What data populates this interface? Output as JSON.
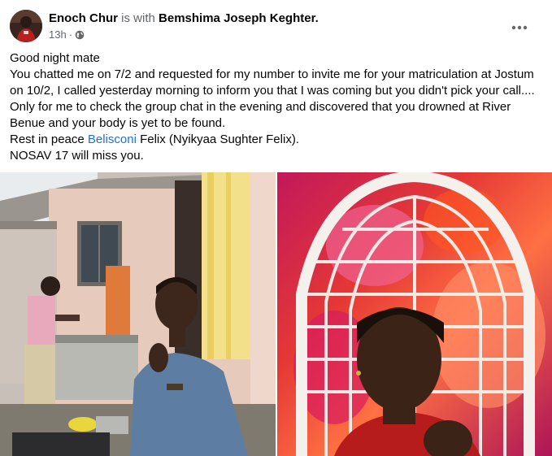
{
  "post": {
    "author": "Enoch Chur",
    "with_text": "is with",
    "tagged": "Bemshima Joseph Keghter.",
    "time": "13h",
    "separator": "·",
    "privacy_icon": "globe-icon",
    "more_icon": "more-options-icon",
    "lines": [
      "Good night mate",
      "You chatted me on 7/2 and requested for my number to invite me for your matriculation at Jostum on 10/2, I called yesterday morning to inform you that I was coming but you didn't pick your call.... Only for me to check the group chat in the evening and discovered that you drowned at River Benue and your body is yet to be found."
    ],
    "rip_prefix": "Rest in peace ",
    "rip_link": "Belisconi",
    "rip_suffix": " Felix (Nyikyaa Sughter Felix).",
    "closing": "NOSAV 17 will miss you."
  },
  "colors": {
    "link": "#216fdb",
    "muted": "#65676b",
    "text": "#050505"
  }
}
